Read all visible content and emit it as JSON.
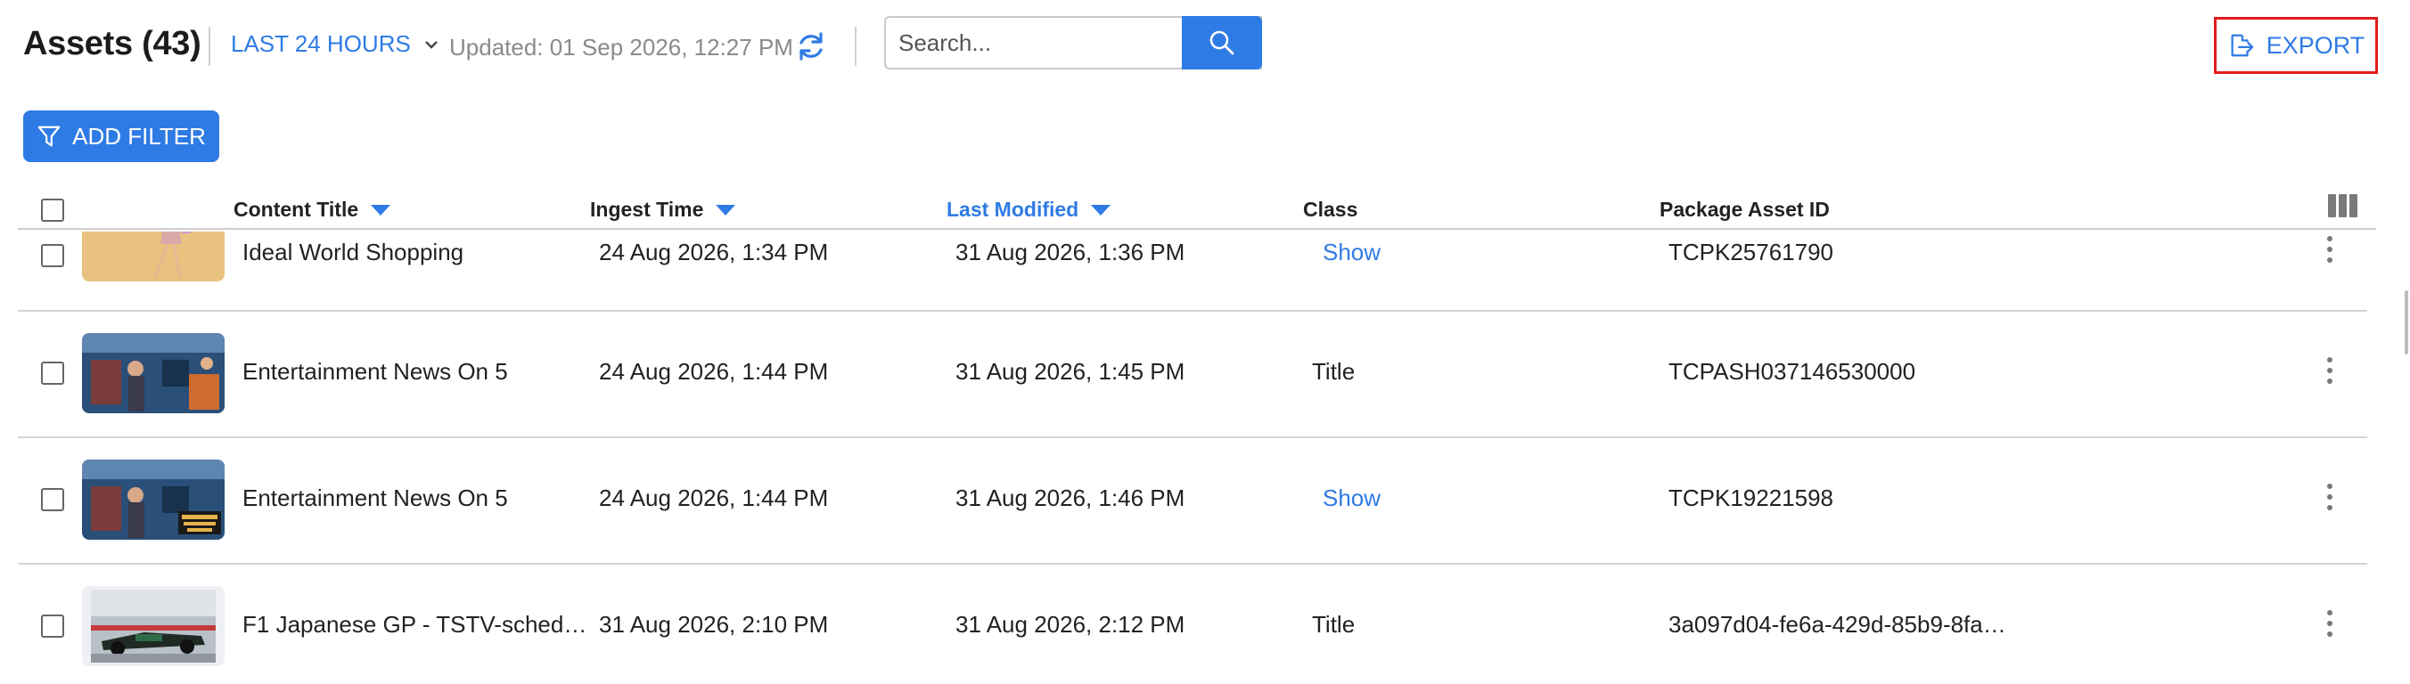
{
  "header": {
    "title": "Assets (43)",
    "time_range": "LAST 24 HOURS",
    "updated": "Updated: 01 Sep 2026, 12:27 PM",
    "search_placeholder": "Search...",
    "export_label": "EXPORT"
  },
  "filter": {
    "add_label": "ADD FILTER"
  },
  "columns": {
    "content_title": "Content Title",
    "ingest_time": "Ingest Time",
    "last_modified": "Last Modified",
    "class": "Class",
    "package_asset_id": "Package Asset ID"
  },
  "rows": [
    {
      "title": "Ideal World Shopping",
      "ingest": "24 Aug 2026, 1:34 PM",
      "modified": "31 Aug 2026, 1:36 PM",
      "class": "Show",
      "asset_id": "TCPK25761790"
    },
    {
      "title": "Entertainment News On 5",
      "ingest": "24 Aug 2026, 1:44 PM",
      "modified": "31 Aug 2026, 1:45 PM",
      "class": "Title",
      "asset_id": "TCPASH037146530000"
    },
    {
      "title": "Entertainment News On 5",
      "ingest": "24 Aug 2026, 1:44 PM",
      "modified": "31 Aug 2026, 1:46 PM",
      "class": "Show",
      "asset_id": "TCPK19221598"
    },
    {
      "title": "F1 Japanese GP - TSTV-sched…",
      "ingest": "31 Aug 2026, 2:10 PM",
      "modified": "31 Aug 2026, 2:12 PM",
      "class": "Title",
      "asset_id": "3a097d04-fe6a-429d-85b9-8fa…"
    }
  ],
  "colors": {
    "accent": "#2f7be5",
    "export_highlight": "#e21b1b"
  }
}
